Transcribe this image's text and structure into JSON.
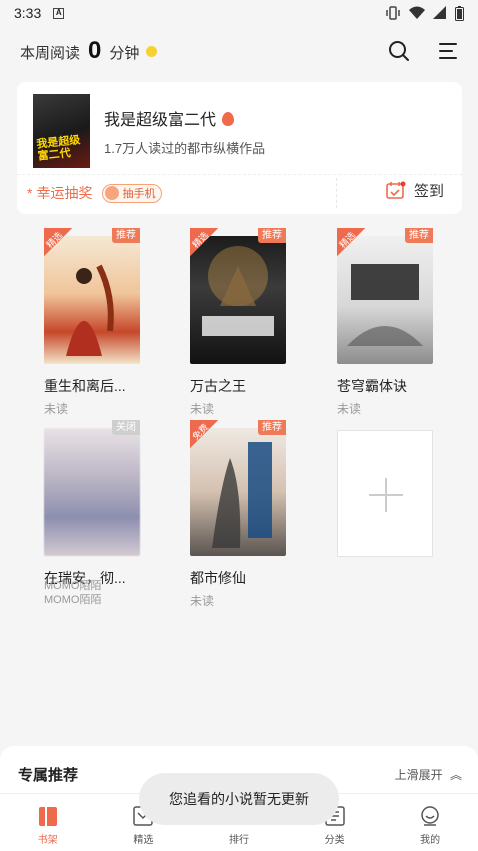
{
  "status_bar": {
    "time": "3:33",
    "notif_badge": "A"
  },
  "header": {
    "weekly_prefix": "本周阅读",
    "weekly_value": "0",
    "weekly_unit": "分钟"
  },
  "featured": {
    "title": "我是超级富二代",
    "cover_text": "我是超级富二代",
    "subtitle": "1.7万人读过的都市纵横作品"
  },
  "lottery": {
    "star": "*",
    "label": "幸运抽奖",
    "chip_label": "抽手机"
  },
  "signin": {
    "label": "签到"
  },
  "books": [
    {
      "name": "重生和离后...",
      "status": "未读",
      "tag": "推荐",
      "corner": "精选"
    },
    {
      "name": "万古之王",
      "status": "未读",
      "tag": "推荐",
      "corner": "精选"
    },
    {
      "name": "苍穹霸体诀",
      "status": "未读",
      "tag": "推荐",
      "corner": "精选"
    },
    {
      "name": "在瑞安，彻...",
      "ad_source_1": "MOMO陌陌",
      "ad_source_2": "MOMO陌陌",
      "tag": "关闭"
    },
    {
      "name": "都市修仙",
      "status": "未读",
      "tag": "推荐",
      "corner": "免费"
    }
  ],
  "recommend": {
    "title": "专属推荐",
    "expand": "上滑展开"
  },
  "toast": "您追看的小说暂无更新",
  "tabs": [
    {
      "label": "书架",
      "icon": "bookshelf-icon",
      "active": true
    },
    {
      "label": "精选",
      "icon": "featured-icon"
    },
    {
      "label": "排行",
      "icon": "ranking-icon"
    },
    {
      "label": "分类",
      "icon": "category-icon"
    },
    {
      "label": "我的",
      "icon": "profile-icon"
    }
  ],
  "colors": {
    "accent": "#ef6a4c",
    "tag": "#ef7a58",
    "coin": "#f5d22e"
  }
}
